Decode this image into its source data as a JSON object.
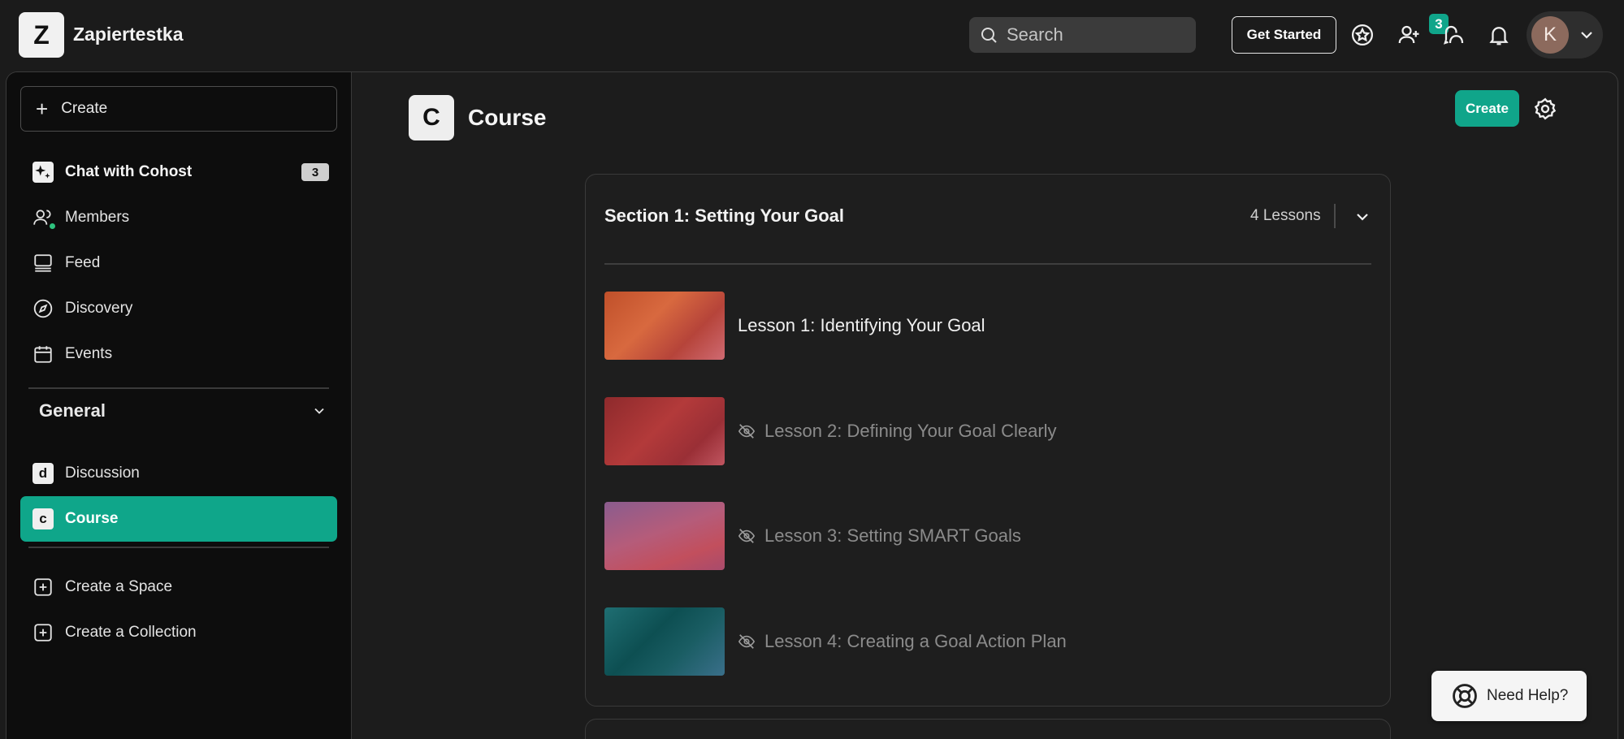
{
  "topbar": {
    "logo_letter": "Z",
    "brand": "Zapiertestka",
    "search_placeholder": "Search",
    "get_started": "Get Started",
    "members_badge": "3",
    "avatar_letter": "K"
  },
  "sidebar": {
    "create_label": "Create",
    "chat_label": "Chat with Cohost",
    "chat_count": "3",
    "members_label": "Members",
    "feed_label": "Feed",
    "discovery_label": "Discovery",
    "events_label": "Events",
    "general_label": "General",
    "discussion_icon_letter": "d",
    "discussion_label": "Discussion",
    "course_icon_letter": "c",
    "course_label": "Course",
    "create_space_label": "Create a Space",
    "create_collection_label": "Create a Collection"
  },
  "main": {
    "page_icon_letter": "C",
    "page_title": "Course",
    "create_label": "Create",
    "section": {
      "title": "Section 1: Setting Your Goal",
      "lessons_count": "4 Lessons",
      "lessons": [
        {
          "title": "Lesson 1: Identifying Your Goal",
          "hidden": false
        },
        {
          "title": "Lesson 2: Defining Your Goal Clearly",
          "hidden": true
        },
        {
          "title": "Lesson 3: Setting SMART Goals",
          "hidden": true
        },
        {
          "title": "Lesson 4: Creating a Goal Action Plan",
          "hidden": true
        }
      ]
    }
  },
  "help": {
    "label": "Need Help?"
  },
  "colors": {
    "accent": "#10a58a",
    "background": "#1b1b1b",
    "sidebar": "#0d0d0d"
  },
  "icons": [
    "search-icon",
    "star-badge-icon",
    "add-user-icon",
    "messages-icon",
    "bell-icon",
    "chevron-down-icon",
    "sparkle-icon",
    "members-icon",
    "feed-icon",
    "compass-icon",
    "calendar-icon",
    "plus-square-icon",
    "gear-icon",
    "eye-off-icon",
    "lifebuoy-icon"
  ]
}
